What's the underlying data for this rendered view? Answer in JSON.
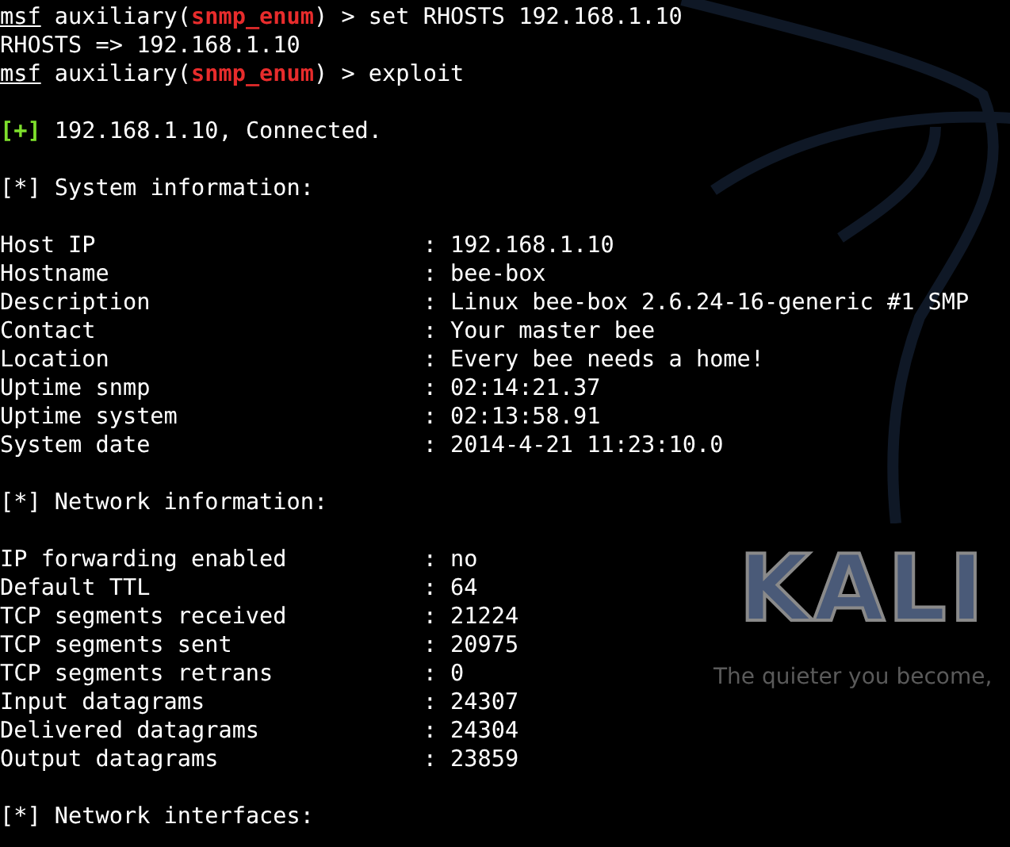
{
  "wallpaper": {
    "logo": "KALI",
    "tagline": "The quieter you become,"
  },
  "terminal": {
    "lines": [
      {
        "kind": "prompt",
        "user": "msf",
        "before": " auxiliary(",
        "module": "snmp_enum",
        "after": ") > set RHOSTS 192.168.1.10"
      },
      {
        "kind": "text",
        "text": "RHOSTS => 192.168.1.10"
      },
      {
        "kind": "prompt",
        "user": "msf",
        "before": " auxiliary(",
        "module": "snmp_enum",
        "after": ") > exploit"
      },
      {
        "kind": "blank"
      },
      {
        "kind": "status",
        "marker": "[+]",
        "good": true,
        "text": " 192.168.1.10, Connected."
      },
      {
        "kind": "blank"
      },
      {
        "kind": "status",
        "marker": "[*]",
        "good": false,
        "text": " System information:"
      },
      {
        "kind": "blank"
      },
      {
        "kind": "field",
        "label": "Host IP",
        "sep": ":",
        "value": "192.168.1.10"
      },
      {
        "kind": "field",
        "label": "Hostname",
        "sep": ":",
        "value": "bee-box"
      },
      {
        "kind": "field",
        "label": "Description",
        "sep": ":",
        "value": "Linux bee-box 2.6.24-16-generic #1 SMP"
      },
      {
        "kind": "field",
        "label": "Contact",
        "sep": ":",
        "value": "Your master bee"
      },
      {
        "kind": "field",
        "label": "Location",
        "sep": ":",
        "value": "Every bee needs a home!"
      },
      {
        "kind": "field",
        "label": "Uptime snmp",
        "sep": ":",
        "value": "02:14:21.37"
      },
      {
        "kind": "field",
        "label": "Uptime system",
        "sep": ":",
        "value": "02:13:58.91"
      },
      {
        "kind": "field",
        "label": "System date",
        "sep": ":",
        "value": "2014-4-21 11:23:10.0"
      },
      {
        "kind": "blank"
      },
      {
        "kind": "status",
        "marker": "[*]",
        "good": false,
        "text": " Network information:"
      },
      {
        "kind": "blank"
      },
      {
        "kind": "field",
        "label": "IP forwarding enabled",
        "sep": ":",
        "value": "no"
      },
      {
        "kind": "field",
        "label": "Default TTL",
        "sep": ":",
        "value": "64"
      },
      {
        "kind": "field",
        "label": "TCP segments received",
        "sep": ":",
        "value": "21224"
      },
      {
        "kind": "field",
        "label": "TCP segments sent",
        "sep": ":",
        "value": "20975"
      },
      {
        "kind": "field",
        "label": "TCP segments retrans",
        "sep": ":",
        "value": "0"
      },
      {
        "kind": "field",
        "label": "Input datagrams",
        "sep": ":",
        "value": "24307"
      },
      {
        "kind": "field",
        "label": "Delivered datagrams",
        "sep": ":",
        "value": "24304"
      },
      {
        "kind": "field",
        "label": "Output datagrams",
        "sep": ":",
        "value": "23859"
      },
      {
        "kind": "blank"
      },
      {
        "kind": "status",
        "marker": "[*]",
        "good": false,
        "text": " Network interfaces:"
      }
    ]
  }
}
